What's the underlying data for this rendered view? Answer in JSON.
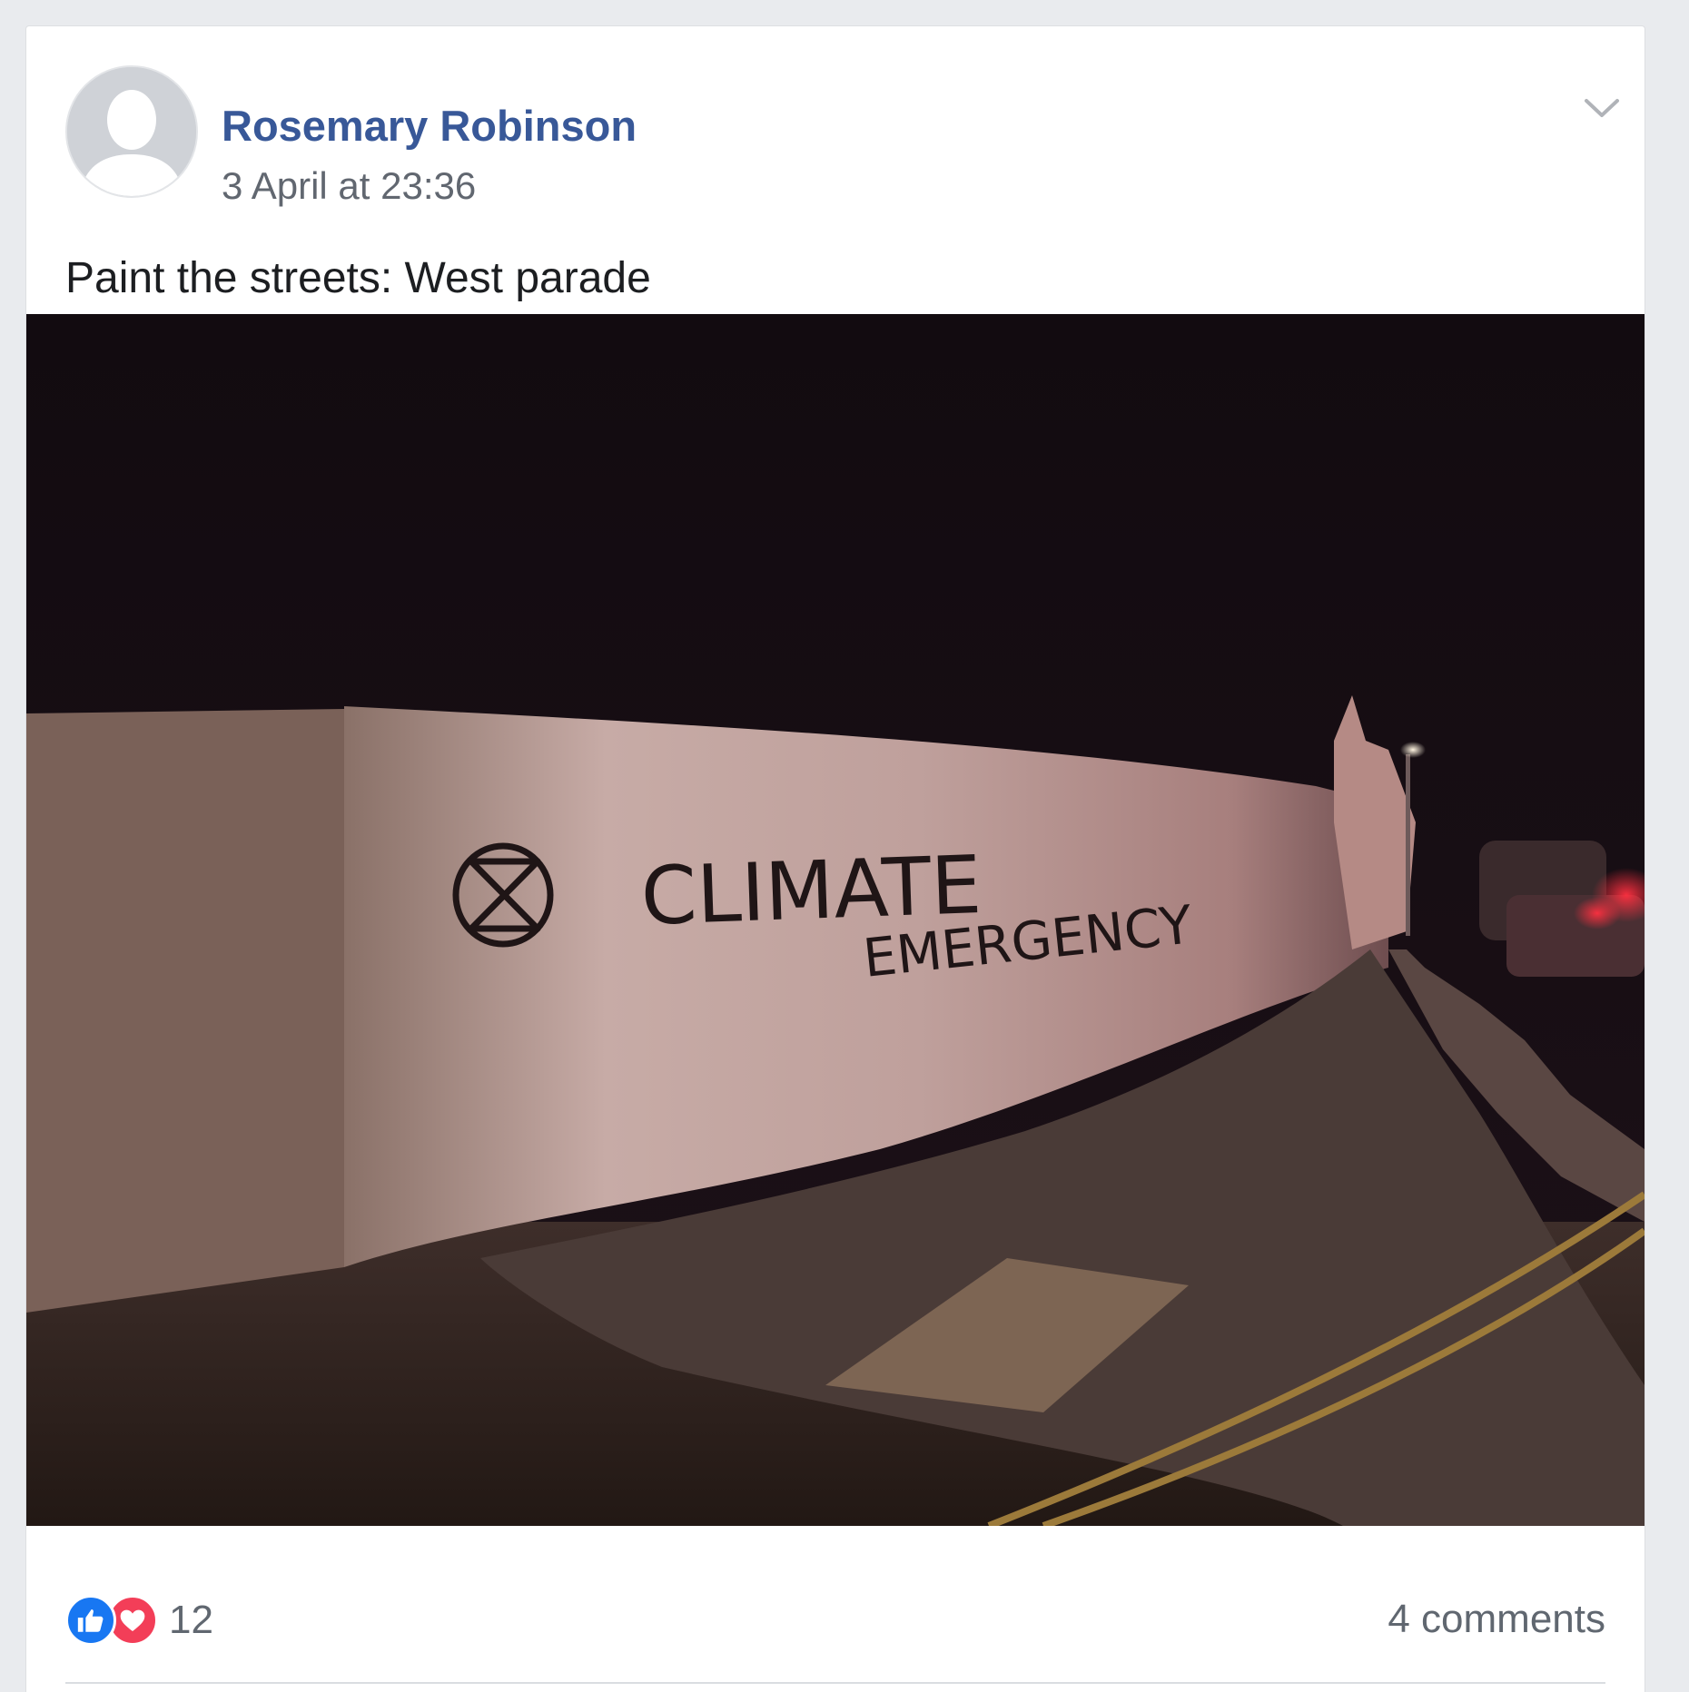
{
  "post": {
    "author": "Rosemary Robinson",
    "timestamp": "3 April at 23:36",
    "text": "Paint the streets: West parade",
    "photo": {
      "graffiti_line1": "CLIMATE",
      "graffiti_line2": "EMERGENCY",
      "symbol": "extinction-symbol"
    },
    "reactions": {
      "icons": [
        "like-icon",
        "love-icon"
      ],
      "count": "12"
    },
    "comments": "4 comments"
  },
  "colors": {
    "author": "#385898",
    "like": "#1877f2",
    "love": "#f33e58",
    "meta": "#606770",
    "background": "#e9ebee"
  }
}
